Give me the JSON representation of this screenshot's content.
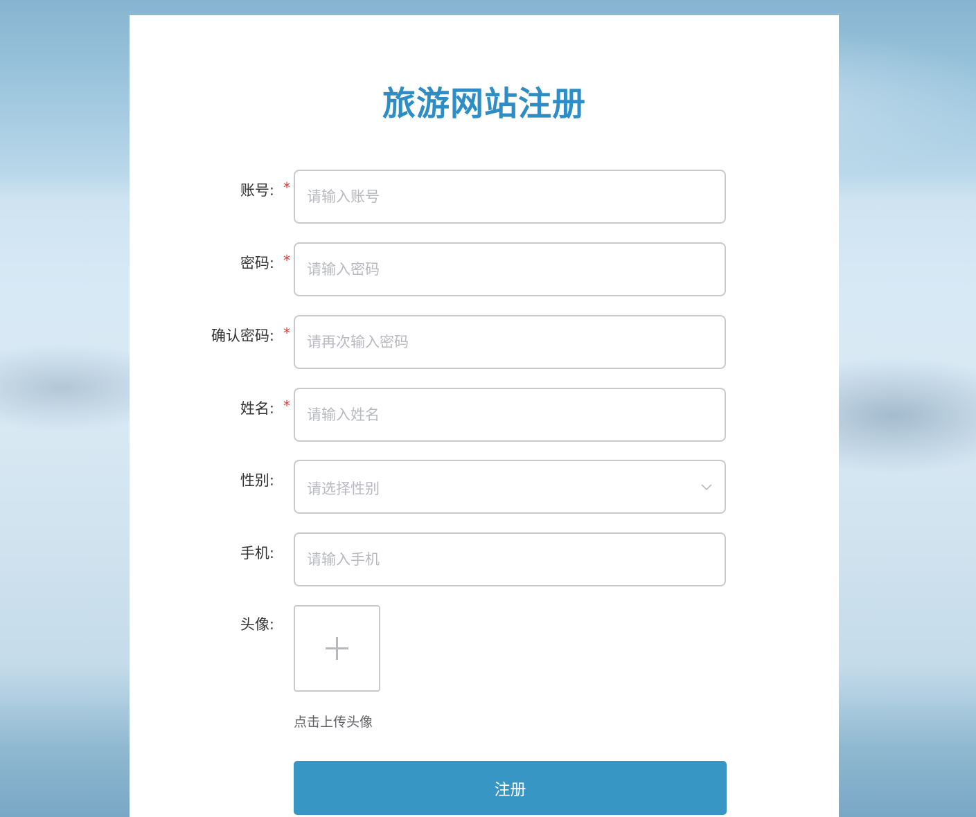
{
  "page": {
    "title": "旅游网站注册"
  },
  "form": {
    "account": {
      "label": "账号:",
      "required_mark": "*",
      "placeholder": "请输入账号"
    },
    "password": {
      "label": "密码:",
      "required_mark": "*",
      "placeholder": "请输入密码"
    },
    "confirm_password": {
      "label": "确认密码:",
      "required_mark": "*",
      "placeholder": "请再次输入密码"
    },
    "name": {
      "label": "姓名:",
      "required_mark": "*",
      "placeholder": "请输入姓名"
    },
    "gender": {
      "label": "性别:",
      "placeholder": "请选择性别",
      "icon": "chevron-down-icon"
    },
    "phone": {
      "label": "手机:",
      "placeholder": "请输入手机"
    },
    "avatar": {
      "label": "头像:",
      "icon": "plus-icon",
      "tip": "点击上传头像"
    },
    "submit_label": "注册"
  },
  "colors": {
    "title": "#2e8dc4",
    "button": "#3896c5",
    "required": "#e53935",
    "border": "#c8c9cc",
    "placeholder": "#b7b9bf"
  }
}
